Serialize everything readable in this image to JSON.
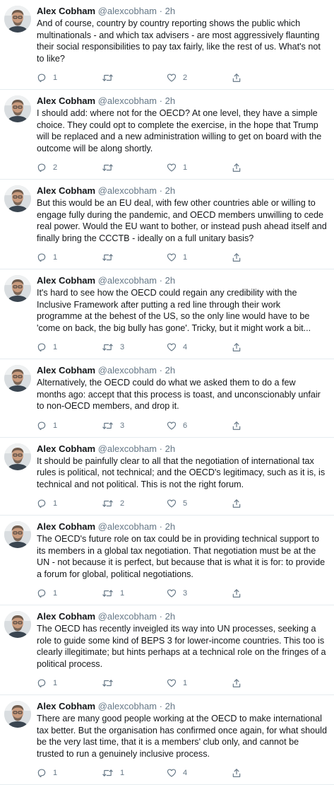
{
  "icons": [
    "reply-icon",
    "retweet-icon",
    "like-icon",
    "share-icon"
  ],
  "colors": {
    "text": "#14171a",
    "muted": "#657786",
    "divider": "#e6ecf0"
  },
  "tweets": [
    {
      "name": "Alex Cobham",
      "handle": "@alexcobham",
      "sep": "·",
      "time": "2h",
      "text": "And of course, country by country reporting shows the public which multinationals - and which tax advisers - are most aggressively flaunting their social responsibilities to pay tax fairly, like the rest of us. What's not to like?",
      "replies": "1",
      "retweets": "",
      "likes": "2"
    },
    {
      "name": "Alex Cobham",
      "handle": "@alexcobham",
      "sep": "·",
      "time": "2h",
      "text": "I should add: where not for the OECD? At one level, they have a simple choice. They could opt to complete the exercise, in the hope that Trump will be replaced and a new administration willing to get on board with the outcome will be along shortly.",
      "replies": "2",
      "retweets": "",
      "likes": "1"
    },
    {
      "name": "Alex Cobham",
      "handle": "@alexcobham",
      "sep": "·",
      "time": "2h",
      "text": "But this would be an EU deal, with few other countries able or willing to engage fully during the pandemic, and OECD members unwilling to cede real power. Would the EU want to bother, or instead push ahead itself and finally bring the CCCTB - ideally on a full unitary basis?",
      "replies": "1",
      "retweets": "",
      "likes": "1"
    },
    {
      "name": "Alex Cobham",
      "handle": "@alexcobham",
      "sep": "·",
      "time": "2h",
      "text": "It's hard to see how the OECD could regain any credibility with the Inclusive Framework after putting a red line through their work programme at the behest of the US, so the only line would have to be 'come on back, the big bully has gone'. Tricky, but it might work a bit...",
      "replies": "1",
      "retweets": "3",
      "likes": "4"
    },
    {
      "name": "Alex Cobham",
      "handle": "@alexcobham",
      "sep": "·",
      "time": "2h",
      "text": "Alternatively, the OECD could do what we asked them to do a few months ago: accept that this process is toast, and unconscionably unfair to non-OECD members, and drop it.",
      "replies": "1",
      "retweets": "3",
      "likes": "6"
    },
    {
      "name": "Alex Cobham",
      "handle": "@alexcobham",
      "sep": "·",
      "time": "2h",
      "text": "It should be painfully clear to all that the negotiation of international tax rules is political, not technical; and the OECD's legitimacy, such as it is, is technical and not political. This is not the right forum.",
      "replies": "1",
      "retweets": "2",
      "likes": "5"
    },
    {
      "name": "Alex Cobham",
      "handle": "@alexcobham",
      "sep": "·",
      "time": "2h",
      "text": "The OECD's future role on tax could be in providing technical support to its members in a global tax negotiation. That negotiation must be at the UN - not because it is perfect, but because that is what it is for: to provide a forum for global, political negotiations.",
      "replies": "1",
      "retweets": "1",
      "likes": "3"
    },
    {
      "name": "Alex Cobham",
      "handle": "@alexcobham",
      "sep": "·",
      "time": "2h",
      "text": "The OECD has recently inveigled its way into UN processes, seeking a role to guide some kind of BEPS 3 for lower-income countries. This too is clearly illegitimate; but hints perhaps at a technical role on the fringes of a political process.",
      "replies": "1",
      "retweets": "",
      "likes": "1"
    },
    {
      "name": "Alex Cobham",
      "handle": "@alexcobham",
      "sep": "·",
      "time": "2h",
      "text": "There are many good people working at the OECD to make international tax better. But the organisation has confirmed once again, for what should be the very last time, that it is a members' club only, and cannot be trusted to run a genuinely inclusive process.",
      "replies": "1",
      "retweets": "1",
      "likes": "4"
    }
  ]
}
